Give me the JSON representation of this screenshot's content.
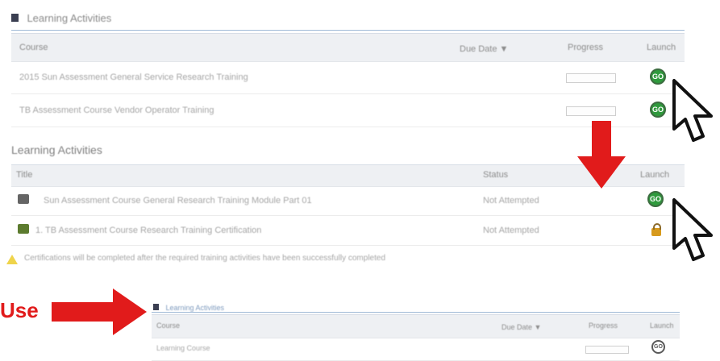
{
  "top_panel": {
    "title": "Learning Activities",
    "columns": {
      "course": "Course",
      "due_date": "Due Date ▼",
      "progress": "Progress",
      "launch": "Launch"
    },
    "rows": [
      {
        "course": "2015 Sun Assessment General Service Research Training",
        "progress": "",
        "launch": "GO"
      },
      {
        "course": "TB Assessment Course Vendor Operator Training",
        "progress": "",
        "launch": "GO"
      }
    ]
  },
  "middle_panel": {
    "title": "Learning Activities",
    "columns": {
      "title": "Title",
      "status": "Status",
      "launch": "Launch"
    },
    "rows": [
      {
        "title": "Sun Assessment Course General Research Training Module Part 01",
        "status": "Not Attempted",
        "launch": "GO"
      },
      {
        "title": "1. TB Assessment Course Research Training Certification",
        "status": "Not Attempted",
        "launch": "locked"
      }
    ],
    "note": "Certifications will be completed after the required training activities have been successfully completed"
  },
  "bottom_panel": {
    "title": "Learning Activities",
    "columns": {
      "course": "Course",
      "due_date": "Due Date ▼",
      "progress": "Progress",
      "launch": "Launch"
    },
    "rows": [
      {
        "course": "Learning Course",
        "progress": "",
        "launch": "GO"
      }
    ]
  },
  "annotations": {
    "use_label": "Use"
  },
  "colors": {
    "arrow_red": "#e11b1b",
    "go_green": "#2f9a3d",
    "lock_gold": "#d79a1d"
  }
}
